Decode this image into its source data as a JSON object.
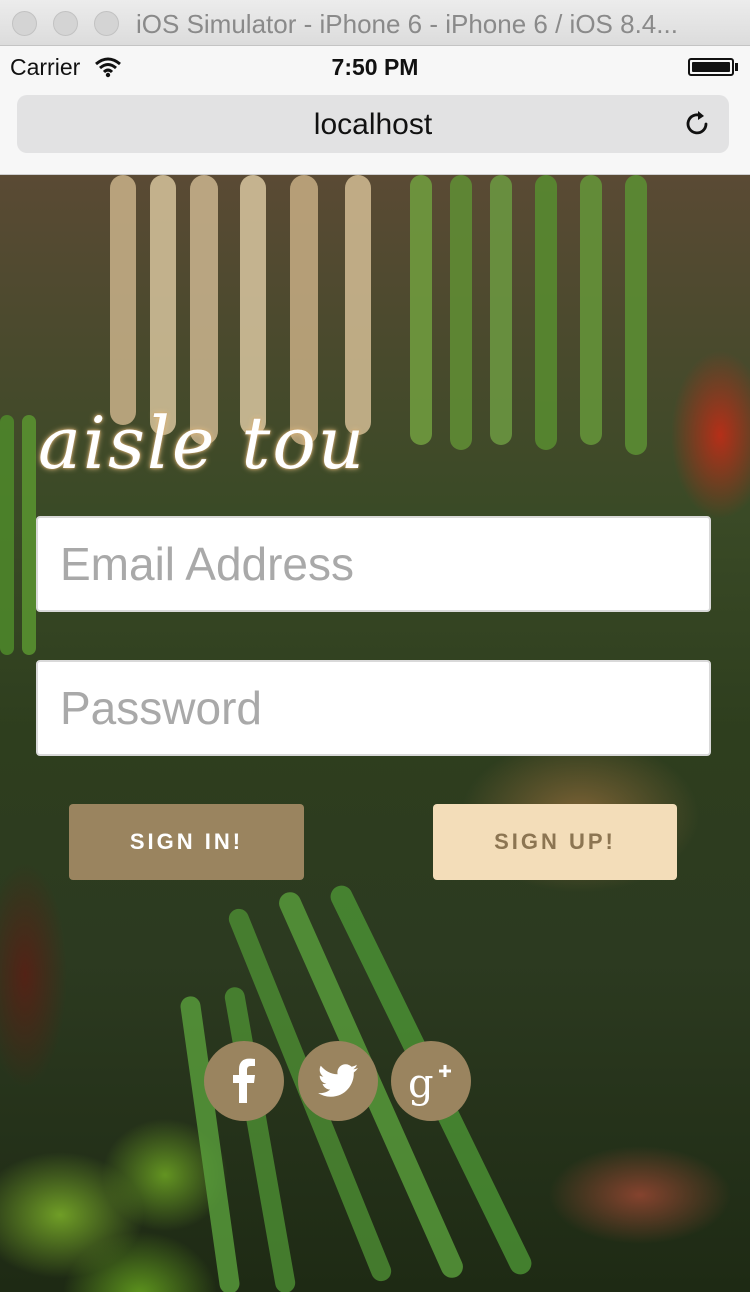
{
  "window": {
    "title": "iOS Simulator - iPhone 6 - iPhone 6 / iOS 8.4..."
  },
  "status_bar": {
    "carrier": "Carrier",
    "time": "7:50 PM"
  },
  "browser": {
    "url": "localhost"
  },
  "app": {
    "logo": "aisle tou"
  },
  "login": {
    "email_placeholder": "Email Address",
    "password_placeholder": "Password",
    "sign_in_label": "SIGN IN!",
    "sign_up_label": "SIGN UP!"
  },
  "social": [
    "facebook-icon",
    "twitter-icon",
    "google-plus-icon"
  ],
  "colors": {
    "accent": "#9a845f",
    "accent_light": "#f3ddb9",
    "accent_light_text": "#8c7552"
  }
}
